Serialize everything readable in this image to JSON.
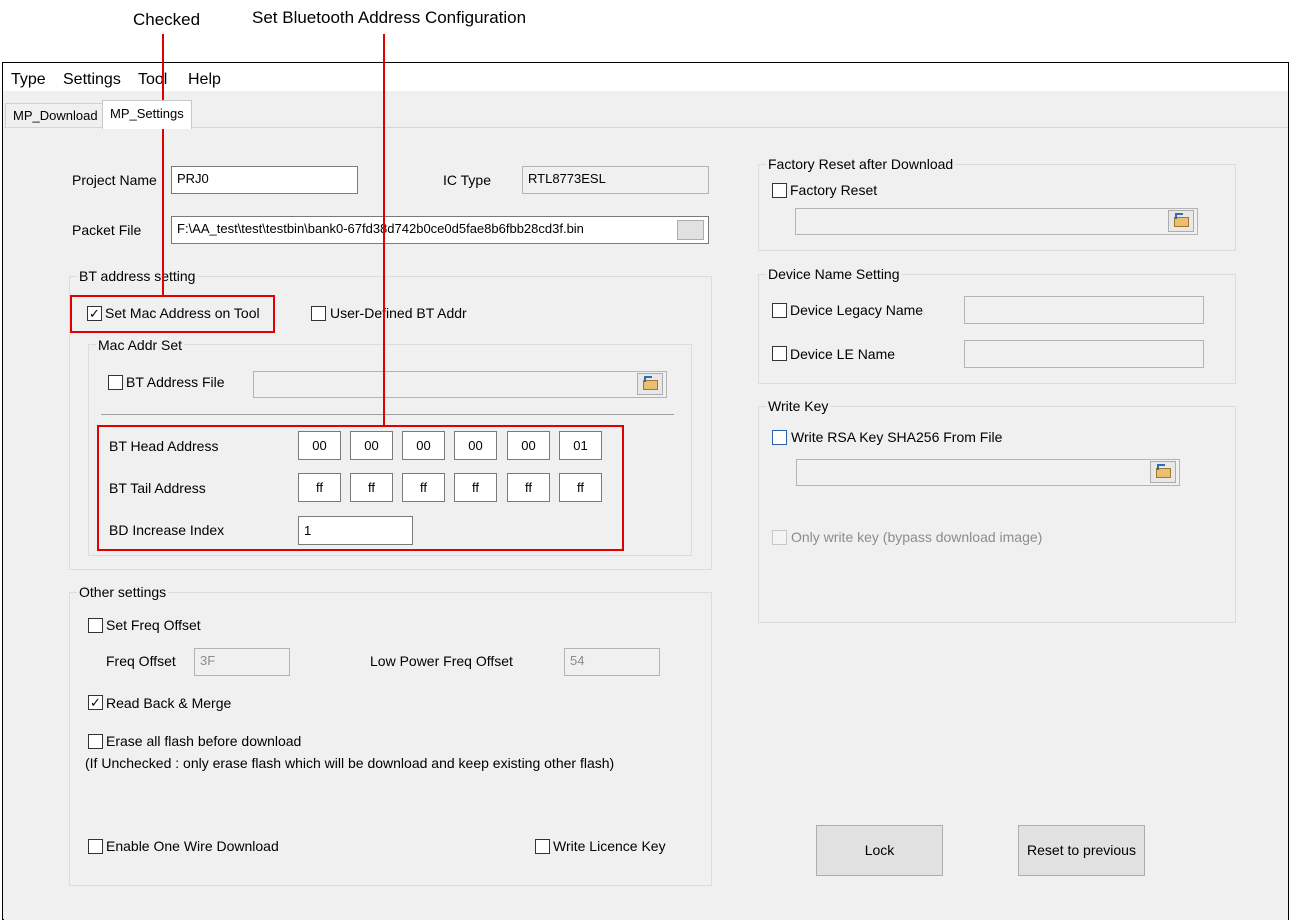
{
  "annotations": {
    "checked": "Checked",
    "bt_config": "Set Bluetooth Address Configuration"
  },
  "menu": [
    "Type",
    "Settings",
    "Tool",
    "Help"
  ],
  "tabs": [
    {
      "label": "MP_Download",
      "active": false
    },
    {
      "label": "MP_Settings",
      "active": true
    }
  ],
  "project": {
    "name_label": "Project Name",
    "name_value": "PRJ0",
    "ic_type_label": "IC Type",
    "ic_type_value": "RTL8773ESL",
    "packet_file_label": "Packet File",
    "packet_file_value": "F:\\AA_test\\test\\testbin\\bank0-67fd38d742b0ce0d5fae8b6fbb28cd3f.bin"
  },
  "bt_address": {
    "group_title": "BT address setting",
    "set_mac_label": "Set Mac Address on Tool",
    "set_mac_checked": true,
    "user_defined_label": "User-Defined BT Addr",
    "user_defined_checked": false,
    "mac_addr_set_title": "Mac Addr Set",
    "bt_address_file_label": "BT Address File",
    "bt_address_file_checked": false,
    "head_label": "BT Head Address",
    "head_values": [
      "00",
      "00",
      "00",
      "00",
      "00",
      "01"
    ],
    "tail_label": "BT Tail Address",
    "tail_values": [
      "ff",
      "ff",
      "ff",
      "ff",
      "ff",
      "ff"
    ],
    "increase_label": "BD Increase Index",
    "increase_value": "1"
  },
  "other_settings": {
    "group_title": "Other settings",
    "set_freq_offset_label": "Set Freq Offset",
    "set_freq_offset_checked": false,
    "freq_offset_label": "Freq Offset",
    "freq_offset_value": "3F",
    "low_power_label": "Low Power Freq Offset",
    "low_power_value": "54",
    "read_back_label": "Read Back & Merge",
    "read_back_checked": true,
    "erase_label": "Erase all flash before download",
    "erase_checked": false,
    "erase_note": "(If Unchecked : only erase flash which will be download and keep existing other flash)",
    "one_wire_label": "Enable One Wire Download",
    "one_wire_checked": false,
    "licence_label": "Write Licence Key",
    "licence_checked": false
  },
  "factory_reset": {
    "group_title": "Factory Reset after Download",
    "checkbox_label": "Factory Reset",
    "checked": false
  },
  "device_name": {
    "group_title": "Device Name Setting",
    "legacy_label": "Device Legacy Name",
    "legacy_checked": false,
    "le_label": "Device LE Name",
    "le_checked": false
  },
  "write_key": {
    "group_title": "Write Key",
    "rsa_label": "Write RSA Key SHA256 From File",
    "rsa_checked": false,
    "only_key_label": "Only write key (bypass download image)",
    "only_key_checked": false
  },
  "buttons": {
    "lock": "Lock",
    "reset": "Reset to previous"
  },
  "colors": {
    "annotation": "#e00000",
    "window_bg": "#f0f0f0"
  }
}
